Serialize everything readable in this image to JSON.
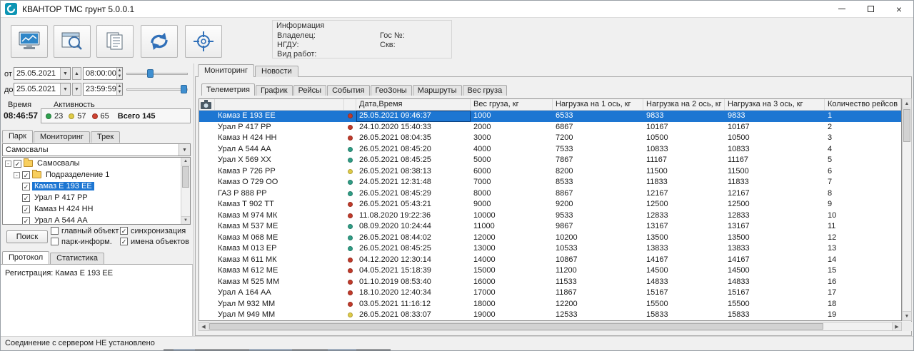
{
  "window": {
    "title": "КВАНТОР ТМС грунт 5.0.0.1",
    "status_bar": "Соединение с сервером НЕ установлено"
  },
  "info": {
    "title": "Информация",
    "owner": "Владелец:",
    "ngdu": "НГДУ:",
    "work": "Вид работ:",
    "gos": "Гос №:",
    "skv": "Скв:"
  },
  "filters": {
    "from_label": "от",
    "from_date": "25.05.2021",
    "from_time": "08:00:00",
    "from_slider": 34,
    "to_label": "до",
    "to_date": "25.05.2021",
    "to_time": "23:59:59",
    "to_slider": 88
  },
  "activity": {
    "time_label": "Время",
    "activity_label": "Активность",
    "clock": "08:46:57",
    "counts": [
      {
        "color": "#2fa14e",
        "value": "23"
      },
      {
        "color": "#dfcb47",
        "value": "57"
      },
      {
        "color": "#cf4232",
        "value": "65"
      }
    ],
    "total": "Всего 145"
  },
  "left_tabs": {
    "items": [
      "Парк",
      "Мониторинг",
      "Трек"
    ],
    "active": 0
  },
  "park_combo": {
    "value": "Самосвалы"
  },
  "tree": {
    "items": [
      {
        "label": "Самосвалы",
        "level": 0,
        "checked": true,
        "folder": true,
        "expander": true
      },
      {
        "label": "Подразделение 1",
        "level": 1,
        "checked": true,
        "folder": true,
        "expander": true
      },
      {
        "label": "Камаз Е 193 ЕЕ",
        "level": 2,
        "checked": true,
        "selected": true
      },
      {
        "label": "Урал Р 417 РР",
        "level": 2,
        "checked": true
      },
      {
        "label": "Камаз Н 424 НН",
        "level": 2,
        "checked": true
      },
      {
        "label": "Урал А 544 АА",
        "level": 2,
        "checked": true
      }
    ]
  },
  "search": {
    "button": "Поиск",
    "checkboxes": [
      {
        "label": "главный объект",
        "checked": false
      },
      {
        "label": "парк-информ.",
        "checked": false
      },
      {
        "label": "синхронизация",
        "checked": true
      },
      {
        "label": "имена объектов",
        "checked": true
      }
    ]
  },
  "protocol_tabs": {
    "items": [
      "Протокол",
      "Статистика"
    ],
    "active": 0
  },
  "protocol": {
    "text": "Регистрация: Камаз Е 193 ЕЕ"
  },
  "main_tabs": {
    "items": [
      "Мониторинг",
      "Новости"
    ],
    "active": 0
  },
  "sub_tabs": {
    "items": [
      "Телеметрия",
      "График",
      "Рейсы",
      "События",
      "ГеоЗоны",
      "Маршруты",
      "Вес груза"
    ],
    "active": 0
  },
  "colors": {
    "selection": "#1d76d2",
    "status": {
      "red": "#c13a2a",
      "green": "#2f9d85",
      "yellow": "#dfcb47"
    }
  },
  "table": {
    "headers": [
      "Дата,Время",
      "Вес  груза, кг",
      "Нагрузка  на 1 ось, кг",
      "Нагрузка  на 2 ось, кг",
      "Нагрузка  на 3 ось, кг",
      "Количество  рейсов"
    ],
    "rows": [
      {
        "name": "Камаз Е 193 ЕЕ",
        "status": "red",
        "datetime": "25.05.2021 09:46:37",
        "weight": "1000",
        "axle1": "6533",
        "axle2": "9833",
        "axle3": "9833",
        "trips": "1",
        "selected": true
      },
      {
        "name": "Урал Р 417 РР",
        "status": "red",
        "datetime": "24.10.2020 15:40:33",
        "weight": "2000",
        "axle1": "6867",
        "axle2": "10167",
        "axle3": "10167",
        "trips": "2"
      },
      {
        "name": "Камаз Н 424 НН",
        "status": "red",
        "datetime": "26.05.2021 08:04:35",
        "weight": "3000",
        "axle1": "7200",
        "axle2": "10500",
        "axle3": "10500",
        "trips": "3"
      },
      {
        "name": "Урал А 544 АА",
        "status": "green",
        "datetime": "26.05.2021 08:45:20",
        "weight": "4000",
        "axle1": "7533",
        "axle2": "10833",
        "axle3": "10833",
        "trips": "4"
      },
      {
        "name": "Урал Х 569 ХХ",
        "status": "green",
        "datetime": "26.05.2021 08:45:25",
        "weight": "5000",
        "axle1": "7867",
        "axle2": "11167",
        "axle3": "11167",
        "trips": "5"
      },
      {
        "name": "Камаз Р 726 РР",
        "status": "yellow",
        "datetime": "26.05.2021 08:38:13",
        "weight": "6000",
        "axle1": "8200",
        "axle2": "11500",
        "axle3": "11500",
        "trips": "6"
      },
      {
        "name": "Камаз О 729 ОО",
        "status": "green",
        "datetime": "24.05.2021 12:31:48",
        "weight": "7000",
        "axle1": "8533",
        "axle2": "11833",
        "axle3": "11833",
        "trips": "7"
      },
      {
        "name": "ГАЗ Р 888 РР",
        "status": "green",
        "datetime": "26.05.2021 08:45:29",
        "weight": "8000",
        "axle1": "8867",
        "axle2": "12167",
        "axle3": "12167",
        "trips": "8"
      },
      {
        "name": "Камаз Т 902 ТТ",
        "status": "red",
        "datetime": "26.05.2021 05:43:21",
        "weight": "9000",
        "axle1": "9200",
        "axle2": "12500",
        "axle3": "12500",
        "trips": "9"
      },
      {
        "name": "Камаз М 974 МК",
        "status": "red",
        "datetime": "11.08.2020 19:22:36",
        "weight": "10000",
        "axle1": "9533",
        "axle2": "12833",
        "axle3": "12833",
        "trips": "10"
      },
      {
        "name": "Камаз М 537 МЕ",
        "status": "green",
        "datetime": "08.09.2020 10:24:44",
        "weight": "11000",
        "axle1": "9867",
        "axle2": "13167",
        "axle3": "13167",
        "trips": "11"
      },
      {
        "name": "Камаз М 068 МЕ",
        "status": "green",
        "datetime": "26.05.2021 08:44:02",
        "weight": "12000",
        "axle1": "10200",
        "axle2": "13500",
        "axle3": "13500",
        "trips": "12"
      },
      {
        "name": "Камаз М 013 ЕР",
        "status": "green",
        "datetime": "26.05.2021 08:45:25",
        "weight": "13000",
        "axle1": "10533",
        "axle2": "13833",
        "axle3": "13833",
        "trips": "13"
      },
      {
        "name": "Камаз М 611 МК",
        "status": "red",
        "datetime": "04.12.2020 12:30:14",
        "weight": "14000",
        "axle1": "10867",
        "axle2": "14167",
        "axle3": "14167",
        "trips": "14"
      },
      {
        "name": "Камаз М 612 МЕ",
        "status": "red",
        "datetime": "04.05.2021 15:18:39",
        "weight": "15000",
        "axle1": "11200",
        "axle2": "14500",
        "axle3": "14500",
        "trips": "15"
      },
      {
        "name": "Камаз М 525 ММ",
        "status": "red",
        "datetime": "01.10.2019 08:53:40",
        "weight": "16000",
        "axle1": "11533",
        "axle2": "14833",
        "axle3": "14833",
        "trips": "16"
      },
      {
        "name": "Урал А 164 АА",
        "status": "red",
        "datetime": "18.10.2020 12:40:34",
        "weight": "17000",
        "axle1": "11867",
        "axle2": "15167",
        "axle3": "15167",
        "trips": "17"
      },
      {
        "name": "Урал М 932 ММ",
        "status": "red",
        "datetime": "03.05.2021 11:16:12",
        "weight": "18000",
        "axle1": "12200",
        "axle2": "15500",
        "axle3": "15500",
        "trips": "18"
      },
      {
        "name": "Урал М 949 ММ",
        "status": "yellow",
        "datetime": "26.05.2021 08:33:07",
        "weight": "19000",
        "axle1": "12533",
        "axle2": "15833",
        "axle3": "15833",
        "trips": "19"
      }
    ]
  }
}
